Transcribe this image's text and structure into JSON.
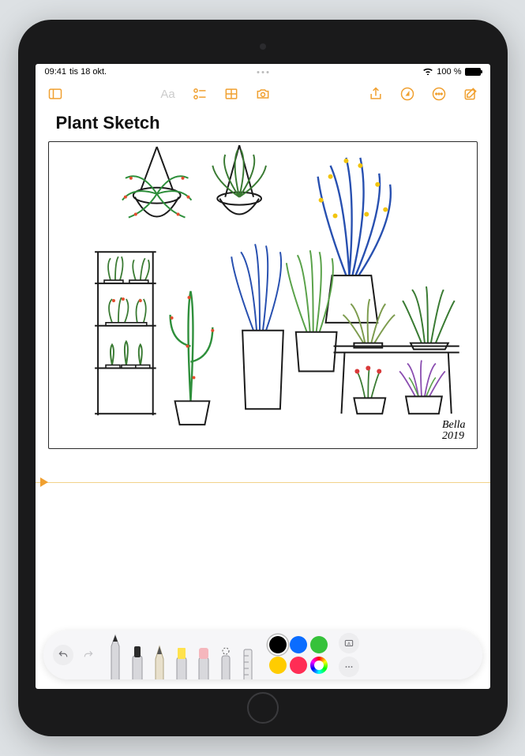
{
  "status": {
    "time": "09:41",
    "date": "tis 18 okt.",
    "battery_pct": "100 %",
    "wifi": true
  },
  "toolbar": {
    "sidebar_icon": "sidebar",
    "text_style": "Aa",
    "checklist": "checklist",
    "table": "table",
    "camera": "camera",
    "share": "share",
    "markup_circle": "markup",
    "more": "more",
    "compose": "compose"
  },
  "note": {
    "title": "Plant Sketch",
    "signature_name": "Bella",
    "signature_year": "2019"
  },
  "markup": {
    "undo": "undo",
    "redo": "redo",
    "tools": [
      "pen",
      "marker",
      "pencil",
      "highlighter",
      "eraser",
      "lasso",
      "ruler"
    ],
    "selected_tool_index": 0,
    "colors": [
      "#000000",
      "#0a6cff",
      "#36c23b",
      "#ffcc00",
      "#ff2d55",
      "wheel"
    ],
    "selected_color_index": 0,
    "text_tool": "A",
    "add_shape": "add",
    "more": "more"
  }
}
